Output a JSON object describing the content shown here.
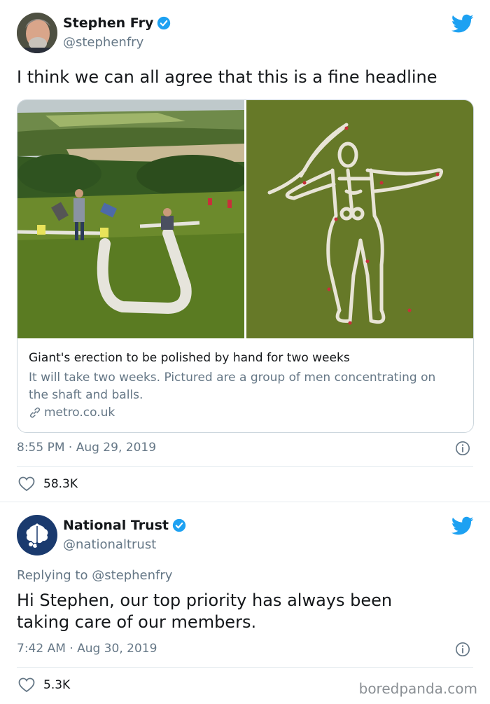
{
  "tweets": [
    {
      "author": {
        "name": "Stephen Fry",
        "handle": "@stephenfry"
      },
      "text": "I think we can all agree that this is a fine headline",
      "card": {
        "title": "Giant's erection to be polished by hand for two weeks",
        "description": "It will take two weeks. Pictured are a group of men concentrating on the shaft and balls.",
        "link": "metro.co.uk"
      },
      "timestamp": "8:55 PM · Aug 29, 2019",
      "likes": "58.3K"
    },
    {
      "author": {
        "name": "National Trust",
        "handle": "@nationaltrust"
      },
      "reply_to": "Replying to @stephenfry",
      "text_line1": "Hi Stephen, our top priority has always been",
      "text_line2": "taking care of our members.",
      "timestamp": "7:42 AM · Aug 30, 2019",
      "likes": "5.3K"
    }
  ],
  "watermark": "boredpanda.com",
  "colors": {
    "twitter_blue": "#1da1f2",
    "secondary_text": "#657786",
    "nt_blue": "#1a3a6e"
  },
  "icons": [
    "twitter-bird-icon",
    "verified-badge-icon",
    "info-icon",
    "heart-icon",
    "link-icon",
    "oak-leaf-logo"
  ]
}
